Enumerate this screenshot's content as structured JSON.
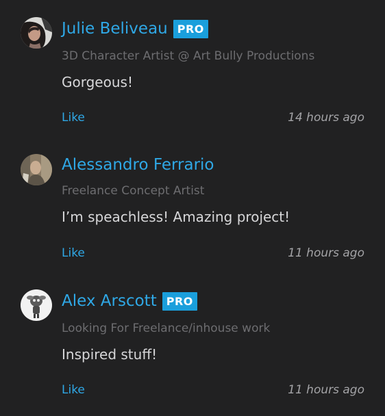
{
  "comments": [
    {
      "author": "Julie Beliveau",
      "badge": "PRO",
      "title": "3D Character Artist @ Art Bully Productions",
      "text": "Gorgeous!",
      "like_label": "Like",
      "time": "14 hours ago"
    },
    {
      "author": "Alessandro Ferrario",
      "badge": "",
      "title": "Freelance Concept Artist",
      "text": "I’m speachless! Amazing project!",
      "like_label": "Like",
      "time": "11 hours ago"
    },
    {
      "author": "Alex Arscott",
      "badge": "PRO",
      "title": "Looking For Freelance/inhouse work",
      "text": "Inspired stuff!",
      "like_label": "Like",
      "time": "11 hours ago"
    }
  ],
  "colors": {
    "background": "#212122",
    "link": "#2fa8e6",
    "badge": "#1a9fdc",
    "muted": "#6d6d70",
    "text": "#d7d7d9"
  }
}
